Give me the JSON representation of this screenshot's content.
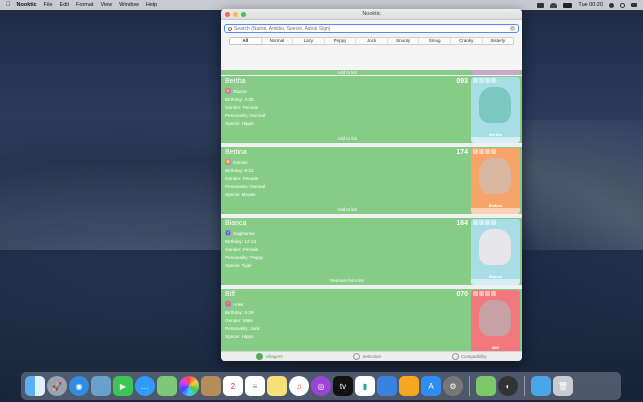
{
  "menubar": {
    "app_name": "Nooktic",
    "items": [
      "File",
      "Edit",
      "Format",
      "View",
      "Window",
      "Help"
    ],
    "clock": "Tue 00:20",
    "battery_icon": "battery-icon",
    "wifi_icon": "wifi-icon"
  },
  "window": {
    "title": "Nooktic",
    "search_placeholder": "Search (Name, Amiibo, Specie, Astral Sign)",
    "filters": [
      "All",
      "Normal",
      "Lazy",
      "Peppy",
      "Jock",
      "Snooty",
      "Smug",
      "Cranky",
      "Sisterly"
    ],
    "active_filter": "All",
    "partial_card": {
      "action": "Add to list"
    },
    "cards": [
      {
        "name": "Bertha",
        "number": "093",
        "sign": "Taurus",
        "birthday": "Birthday: 4-25",
        "gender": "Gender: Female",
        "personality": "Personality: Normal",
        "specie": "Specie: Hippo",
        "action": "Add to list",
        "amiibo_name": "Bertha",
        "amiibo_color": "#a9dde6",
        "portrait_color": "#7cc8c0"
      },
      {
        "name": "Bettina",
        "number": "174",
        "sign": "Gemini",
        "birthday": "Birthday: 6-12",
        "gender": "Gender: Female",
        "personality": "Personality: Normal",
        "specie": "Specie: Mouse",
        "action": "Add to list",
        "amiibo_name": "Bettina",
        "amiibo_color": "#f7a46b",
        "portrait_color": "#d9b7a0"
      },
      {
        "name": "Bianca",
        "number": "164",
        "sign": "Sagittarius",
        "birthday": "Birthday: 12-13",
        "gender": "Gender: Female",
        "personality": "Personality: Peppy",
        "specie": "Specie: Tiger",
        "action": "Remove from list",
        "amiibo_name": "Bianca",
        "amiibo_color": "#a9dde6",
        "portrait_color": "#e6e6ea"
      },
      {
        "name": "Biff",
        "number": "070",
        "sign": "Aries",
        "birthday": "Birthday: 3-29",
        "gender": "Gender: Male",
        "personality": "Personality: Jock",
        "specie": "Specie: Hippo",
        "action": "Add to list",
        "amiibo_name": "Biff",
        "amiibo_color": "#f2787e",
        "portrait_color": "#c7a2a4"
      }
    ],
    "bottom_tabs": [
      {
        "label": "Villagers",
        "active": true
      },
      {
        "label": "Selection",
        "active": false
      },
      {
        "label": "Compatibility",
        "active": false
      }
    ]
  },
  "colors": {
    "card_green": "#86cc86",
    "accent_blue": "#4f8ff7"
  },
  "dock": {
    "apps": [
      "Finder",
      "Launchpad",
      "Safari",
      "Preview",
      "FaceTime",
      "Messages",
      "Maps",
      "Photos",
      "Contacts",
      "Calendar",
      "Reminders",
      "Notes",
      "Music",
      "Podcasts",
      "TV",
      "Numbers",
      "Keynote",
      "Pages",
      "App Store",
      "System Preferences",
      "Nooktic",
      "Instruments",
      "Downloads",
      "Trash"
    ]
  }
}
